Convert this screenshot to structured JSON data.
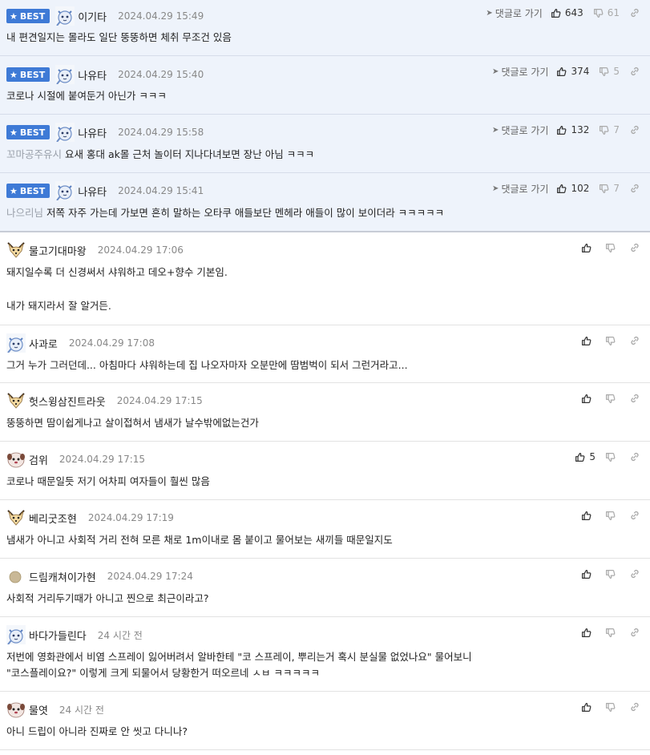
{
  "best_label": "BEST",
  "reply_label": "댓글로 가기",
  "best_comments": [
    {
      "nick": "이기타",
      "avatar": "cat-blue",
      "date": "2024.04.29 15:49",
      "prefix": "",
      "text": "내 편견일지는 몰라도 일단 뚱뚱하면 체취 무조건 있음",
      "up": "643",
      "down": "61"
    },
    {
      "nick": "나유타",
      "avatar": "cat-blue",
      "date": "2024.04.29 15:40",
      "prefix": "",
      "text": "코로나 시절에 붙여둔거 아닌가 ㅋㅋㅋ",
      "up": "374",
      "down": "5"
    },
    {
      "nick": "나유타",
      "avatar": "cat-blue",
      "date": "2024.04.29 15:58",
      "prefix": "꼬마공주유시",
      "text": "요새 홍대 ak몰 근처 놀이터 지나다녀보면 장난 아님 ㅋㅋㅋ",
      "up": "132",
      "down": "7"
    },
    {
      "nick": "나유타",
      "avatar": "cat-blue",
      "date": "2024.04.29 15:41",
      "prefix": "나으리님",
      "text": "저쪽 자주 가는데 가보면 흔히 말하는 오타쿠 애들보단 멘헤라 애들이 많이 보이더라 ㅋㅋㅋㅋㅋ",
      "up": "102",
      "down": "7"
    }
  ],
  "comments": [
    {
      "nick": "물고기대마왕",
      "avatar": "fox",
      "date": "2024.04.29 17:06",
      "lines": [
        "돼지일수록 더 신경써서 샤워하고 데오+향수 기본임.",
        "",
        "내가 돼지라서 잘 알거든."
      ],
      "up": ""
    },
    {
      "nick": "사과로",
      "avatar": "cat-blue",
      "date": "2024.04.29 17:08",
      "lines": [
        "그거 누가 그러던데... 아침마다 샤워하는데 집 나오자마자 오분만에 땀범벅이 되서 그런거라고..."
      ],
      "up": ""
    },
    {
      "nick": "헛스윙삼진트라웃",
      "avatar": "fox",
      "date": "2024.04.29 17:15",
      "lines": [
        "뚱뚱하면 땀이쉽게나고 살이접혀서 냄새가 날수밖에없는건가"
      ],
      "up": ""
    },
    {
      "nick": "검위",
      "avatar": "dog",
      "date": "2024.04.29 17:15",
      "lines": [
        "코로나 때문일듯 저기 어차피 여자들이 훨씬 많음"
      ],
      "up": "5"
    },
    {
      "nick": "베리굿조현",
      "avatar": "fox",
      "date": "2024.04.29 17:19",
      "lines": [
        "냄새가 아니고 사회적 거리 전혀 모른 채로 1m이내로 몸 붙이고 물어보는 새끼들 때문일지도"
      ],
      "up": ""
    },
    {
      "nick": "드림캐쳐이가현",
      "avatar": "dot",
      "date": "2024.04.29 17:24",
      "lines": [
        "사회적 거리두기때가 아니고 찐으로 최근이라고?"
      ],
      "up": ""
    },
    {
      "nick": "바다가들린다",
      "avatar": "cat-blue",
      "date": "24 시간 전",
      "lines": [
        "저번에 영화관에서 비염 스프레이 잃어버려서 알바한테 \"코 스프레이, 뿌리는거 혹시 분실물 없었나요\" 물어보니",
        "\"코스플레이요?\" 이렇게 크게 되물어서 당황한거 떠오르네 ㅅㅂ ㅋㅋㅋㅋㅋ"
      ],
      "up": ""
    },
    {
      "nick": "물엿",
      "avatar": "dog",
      "date": "24 시간 전",
      "lines": [
        "아니 드립이 아니라 진짜로 안 씻고 다니나?"
      ],
      "up": ""
    }
  ]
}
